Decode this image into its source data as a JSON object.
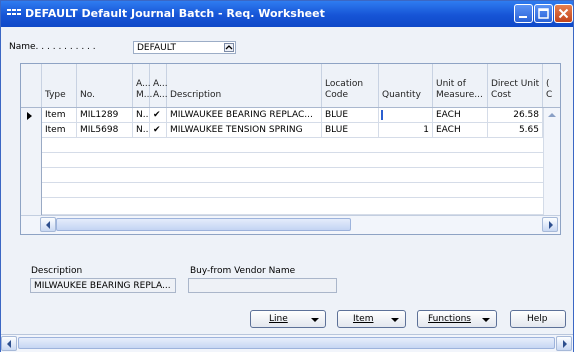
{
  "window": {
    "title": "DEFAULT Default Journal Batch - Req. Worksheet"
  },
  "name_field": {
    "label": "Name. . . . . . . . . . .",
    "value": "DEFAULT"
  },
  "grid": {
    "columns": [
      {
        "key": "type",
        "label": "Type"
      },
      {
        "key": "no",
        "label": "No."
      },
      {
        "key": "a1",
        "label": "A... M..."
      },
      {
        "key": "a2",
        "label": "A... A..."
      },
      {
        "key": "description",
        "label": "Description"
      },
      {
        "key": "location",
        "label": "Location Code"
      },
      {
        "key": "quantity",
        "label": "Quantity"
      },
      {
        "key": "uom",
        "label": "Unit of Measure..."
      },
      {
        "key": "cost",
        "label": "Direct Unit Cost"
      },
      {
        "key": "more",
        "label": "( C"
      }
    ],
    "rows": [
      {
        "type": "Item",
        "no": "MIL1289",
        "a1": "N..",
        "a2": "✔",
        "description": "MILWAUKEE BEARING REPLAC...",
        "location": "BLUE",
        "quantity": "",
        "uom": "EACH",
        "cost": "26.58"
      },
      {
        "type": "Item",
        "no": "MIL5698",
        "a1": "N..",
        "a2": "✔",
        "description": "MILWAUKEE TENSION SPRING",
        "location": "BLUE",
        "quantity": "1",
        "uom": "EACH",
        "cost": "5.65"
      }
    ]
  },
  "footer_fields": {
    "description_label": "Description",
    "description_value": "MILWAUKEE BEARING REPLA...",
    "vendor_label": "Buy-from Vendor Name",
    "vendor_value": ""
  },
  "buttons": {
    "line": "Line",
    "item": "Item",
    "functions": "Functions",
    "help": "Help"
  },
  "colors": {
    "title_bar": "#1654d6",
    "window_bg": "#eef2f8",
    "close_button": "#c2441b"
  }
}
